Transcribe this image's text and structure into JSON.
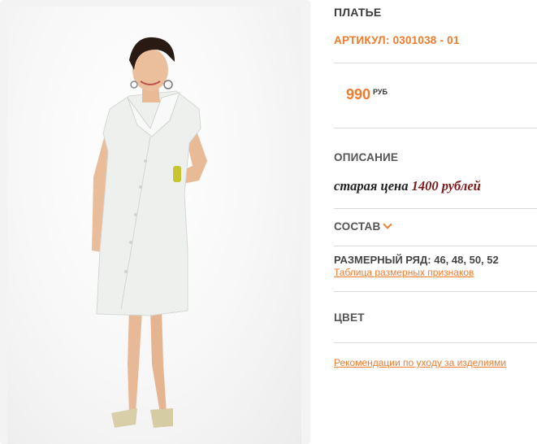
{
  "product": {
    "title": "ПЛАТЬЕ",
    "sku_label": "АРТИКУЛ:",
    "sku_value": "0301038 - 01",
    "price": "990",
    "currency": "РУБ"
  },
  "description": {
    "heading": "ОПИСАНИЕ",
    "old_price_label": "старая цена",
    "old_price_value": "1400 рублей"
  },
  "composition": {
    "label": "СОСТАВ",
    "icon": "chevron-down-icon"
  },
  "sizes": {
    "label": "РАЗМЕРНЫЙ РЯД:",
    "values": "46, 48, 50, 52",
    "table_link": "Таблица размерных признаков"
  },
  "color": {
    "heading": "ЦВЕТ"
  },
  "care": {
    "link": "Рекомендации по уходу за изделиями"
  },
  "colors": {
    "accent": "#f07b2d",
    "old_price": "#7b1a1a",
    "divider": "#d8d8d8"
  }
}
